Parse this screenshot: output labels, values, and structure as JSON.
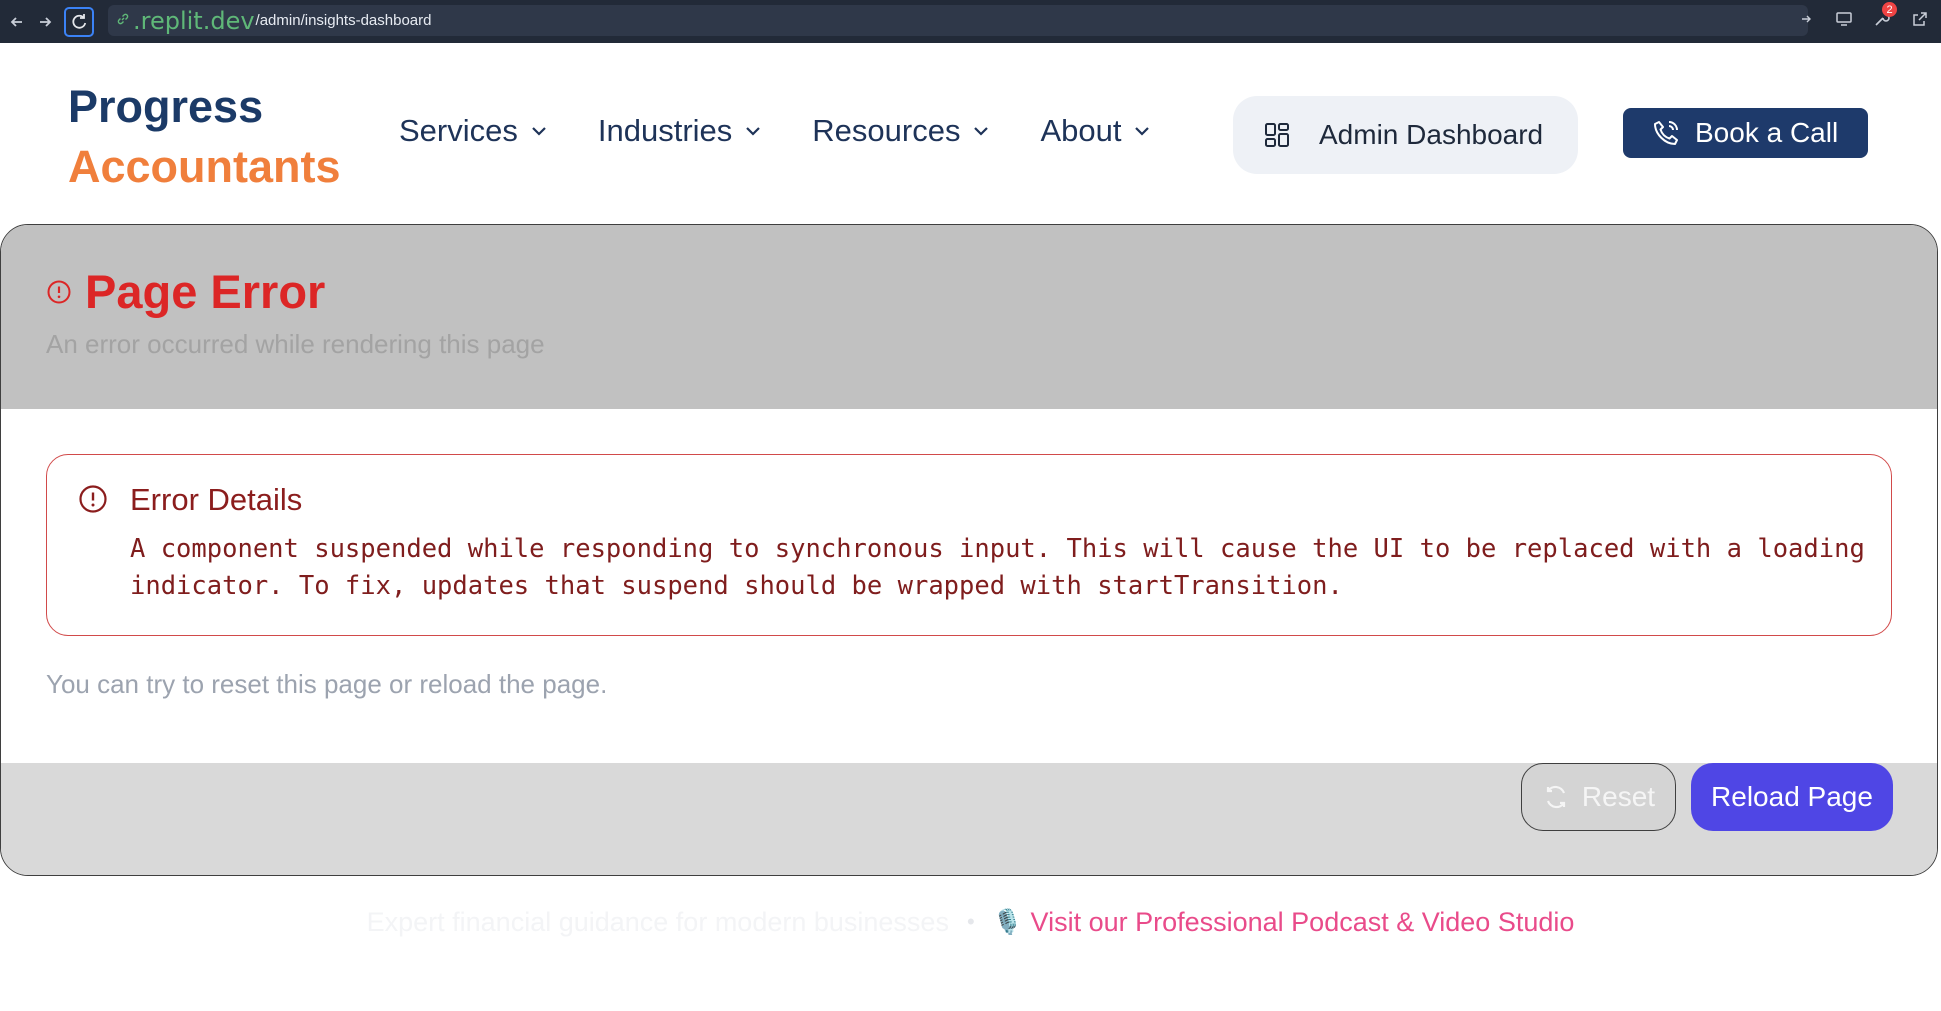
{
  "browser": {
    "url_domain": ".replit.dev",
    "url_path": "/admin/insights-dashboard",
    "notification_count": "2"
  },
  "header": {
    "logo_line1": "Progress",
    "logo_line2": "Accountants",
    "nav": [
      {
        "label": "Services"
      },
      {
        "label": "Industries"
      },
      {
        "label": "Resources"
      },
      {
        "label": "About"
      }
    ],
    "admin_label": "Admin Dashboard",
    "call_label": "Book a Call"
  },
  "error": {
    "title": "Page Error",
    "subtitle": "An error occurred while rendering this page",
    "details_title": "Error Details",
    "details_message": "A component suspended while responding to synchronous input. This will cause the UI to be replaced with a loading indicator. To fix, updates that suspend should be wrapped with startTransition.",
    "hint": "You can try to reset this page or reload the page.",
    "reset_label": "Reset",
    "reload_label": "Reload Page"
  },
  "footer": {
    "tagline": "Expert financial guidance for modern businesses",
    "separator": "•",
    "mic": "🎙️",
    "link": "Visit our Professional Podcast & Video Studio"
  },
  "colors": {
    "brand_navy": "#1b3a67",
    "brand_orange": "#f07f3c",
    "error_red": "#dc2626",
    "primary_indigo": "#4f46e5",
    "link_pink": "#e94b8a"
  },
  "icons": [
    "back-arrow-icon",
    "forward-arrow-icon",
    "reload-icon",
    "link-icon",
    "monitor-icon",
    "wrench-icon",
    "external-link-icon",
    "chevron-down-icon",
    "grid-icon",
    "phone-icon",
    "alert-circle-icon",
    "refresh-icon"
  ]
}
